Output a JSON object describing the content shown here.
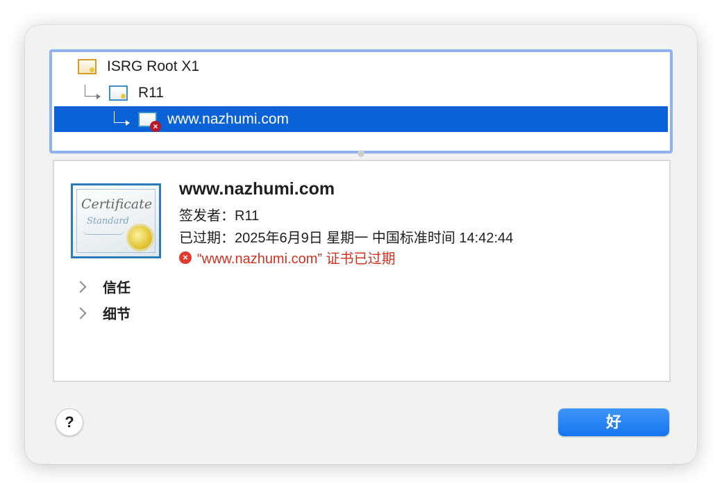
{
  "chain": {
    "items": [
      {
        "label": "ISRG Root X1",
        "icon": "certificate-root-icon"
      },
      {
        "label": "R11",
        "icon": "certificate-intermediate-icon"
      },
      {
        "label": "www.nazhumi.com",
        "icon": "certificate-error-icon",
        "selected": true
      }
    ]
  },
  "details": {
    "title": "www.nazhumi.com",
    "issuer": "签发者：R11",
    "expired": "已过期：2025年6月9日 星期一 中国标准时间 14:42:44",
    "error_message": "“www.nazhumi.com” 证书已过期",
    "large_icon": "certificate-standard-icon",
    "sections": [
      {
        "label": "信任"
      },
      {
        "label": "细节"
      }
    ]
  },
  "footer": {
    "help_label": "?",
    "ok_label": "好"
  },
  "colors": {
    "selection": "#0a62d6",
    "error": "#d43021",
    "ok_button": "#1675ef",
    "focus_ring": "#8fb1f2"
  }
}
